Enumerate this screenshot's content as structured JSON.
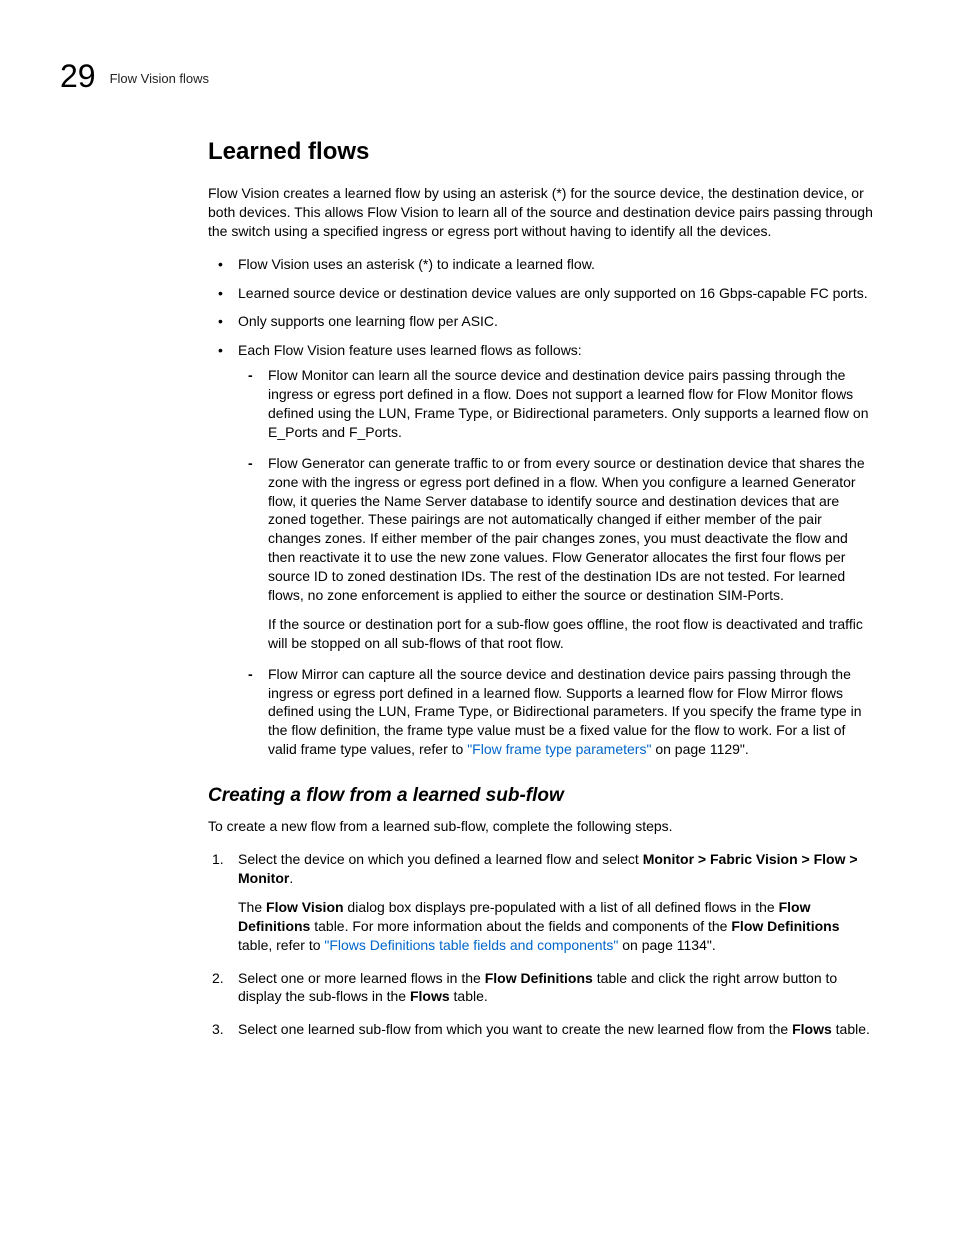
{
  "header": {
    "chapter_number": "29",
    "running_title": "Flow Vision flows"
  },
  "section": {
    "title": "Learned flows",
    "intro": "Flow Vision creates a learned flow by using an asterisk (*) for the source device, the destination device, or both devices. This allows Flow Vision to learn all of the source and destination device pairs passing through the switch using a specified ingress or egress port without having to identify all the devices.",
    "bullets": {
      "b1": "Flow Vision uses an asterisk (*) to indicate a learned flow.",
      "b2": "Learned source device or destination device values are only supported on 16 Gbps-capable FC ports.",
      "b3": "Only supports one learning flow per ASIC.",
      "b4": "Each Flow Vision feature uses learned flows as follows:",
      "d1": "Flow Monitor can learn all the source device and destination device pairs passing through the ingress or egress port defined in a flow. Does not support a learned flow for Flow Monitor flows defined using the LUN, Frame Type, or Bidirectional parameters. Only supports a learned flow on E_Ports and F_Ports.",
      "d2": "Flow Generator can generate traffic to or from every source or destination device that shares the zone with the ingress or egress port defined in a flow. When you configure a learned Generator flow, it queries the Name Server database to identify source and destination devices that are zoned together. These pairings are not automatically changed if either member of the pair changes zones. If either member of the pair changes zones, you must deactivate the flow and then reactivate it to use the new zone values. Flow Generator allocates the first four flows per source ID to zoned destination IDs. The rest of the destination IDs are not tested. For learned flows, no zone enforcement is applied to either the source or destination SIM-Ports.",
      "d2b": "If the source or destination port for a sub-flow goes offline, the root flow is deactivated and traffic will be stopped on all sub-flows of that root flow.",
      "d3a": "Flow Mirror can capture all the source device and destination device pairs passing through the ingress or egress port defined in a learned flow. Supports a learned flow for Flow Mirror flows defined using the LUN, Frame Type, or Bidirectional parameters. If you specify the frame type in the flow definition, the frame type value must be a fixed value for the flow to work. For a list of valid frame type values, refer to ",
      "d3_link": "\"Flow frame type parameters\"",
      "d3b": " on page 1129\"."
    }
  },
  "subsection": {
    "title": "Creating a flow from a learned sub-flow",
    "intro": "To create a new flow from a learned sub-flow, complete the following steps.",
    "step1_a": "Select the device on which you defined a learned flow and select ",
    "step1_bold": "Monitor > Fabric Vision > Flow > Monitor",
    "step1_b": ".",
    "step1p_a": "The ",
    "step1p_b1": "Flow Vision",
    "step1p_c": " dialog box displays pre-populated with a list of all defined flows in the ",
    "step1p_b2": "Flow Definitions",
    "step1p_d": " table. For more information about the fields and components of the ",
    "step1p_b3": "Flow Definitions",
    "step1p_e": " table, refer to ",
    "step1p_link": "\"Flows Definitions table fields and components\"",
    "step1p_f": " on page 1134\".",
    "step2_a": "Select one or more learned flows in the ",
    "step2_b1": "Flow Definitions",
    "step2_b": " table and click the right arrow button to display the sub-flows in the ",
    "step2_b2": "Flows",
    "step2_c": " table.",
    "step3_a": "Select one learned sub-flow from which you want to create the new learned flow from the ",
    "step3_b1": "Flows",
    "step3_b": " table."
  }
}
